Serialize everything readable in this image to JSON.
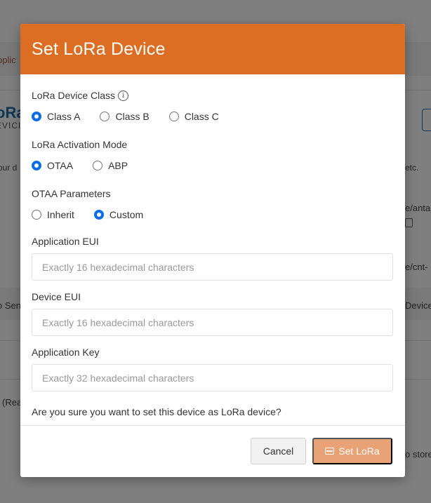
{
  "background": {
    "fragments": [
      "pplic",
      "oRa",
      "EVICI",
      "our d",
      "etc.",
      "e/anta",
      "e/cnt-",
      "o Sen",
      "Device",
      "(Rea",
      "o store"
    ]
  },
  "modal": {
    "title": "Set LoRa Device",
    "device_class": {
      "label": "LoRa Device Class",
      "options": [
        "Class A",
        "Class B",
        "Class C"
      ],
      "selected": "Class A"
    },
    "activation_mode": {
      "label": "LoRa Activation Mode",
      "options": [
        "OTAA",
        "ABP"
      ],
      "selected": "OTAA"
    },
    "otaa_parameters": {
      "label": "OTAA Parameters",
      "options": [
        "Inherit",
        "Custom"
      ],
      "selected": "Custom"
    },
    "application_eui": {
      "label": "Application EUI",
      "value": "",
      "placeholder": "Exactly 16 hexadecimal characters"
    },
    "device_eui": {
      "label": "Device EUI",
      "value": "",
      "placeholder": "Exactly 16 hexadecimal characters"
    },
    "application_key": {
      "label": "Application Key",
      "value": "",
      "placeholder": "Exactly 32 hexadecimal characters"
    },
    "confirm_text": "Are you sure you want to set this device as LoRa device?",
    "cancel_label": "Cancel",
    "submit_label": "Set LoRa"
  },
  "colors": {
    "header": "#dd6d22",
    "submit_button": "#e9a276",
    "radio_checked": "#0b6ee8"
  },
  "icons": {
    "class_info": "info-icon",
    "submit": "lora-device-icon",
    "copy": "copy-icon"
  }
}
